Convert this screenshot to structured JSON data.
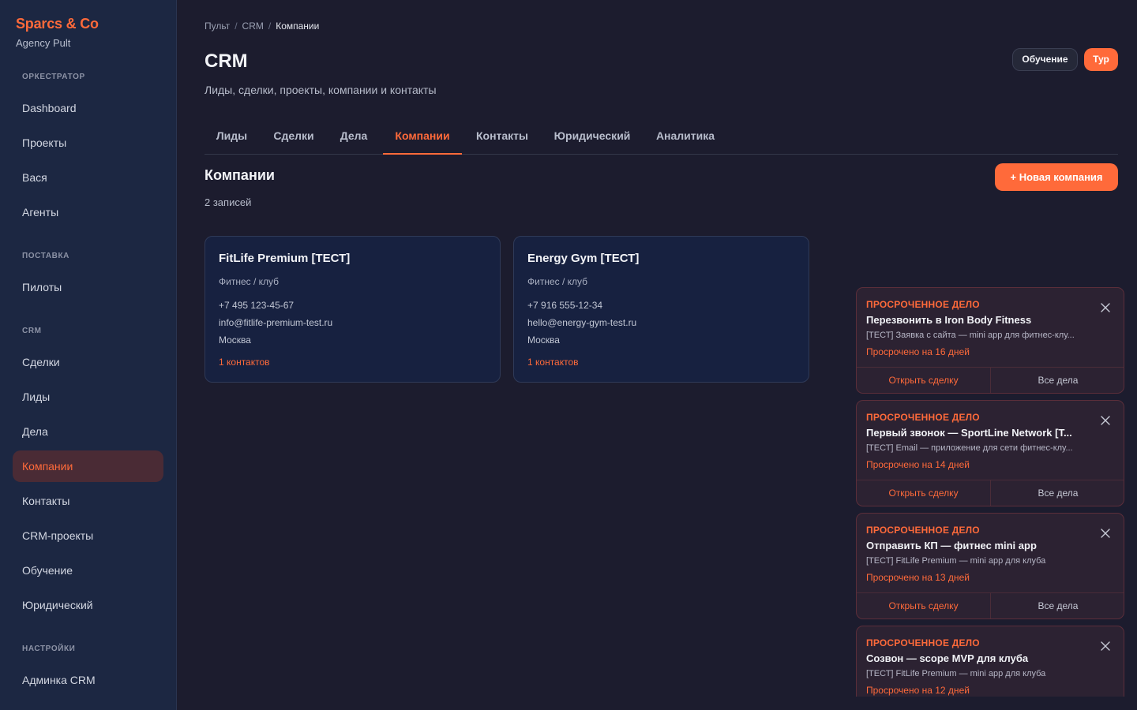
{
  "brand": {
    "name": "Sparcs & Co",
    "subtitle": "Agency Pult"
  },
  "sidebar": {
    "sections": [
      {
        "label": "ОРКЕСТРАТОР"
      },
      {
        "label": "ПОСТАВКА"
      },
      {
        "label": "CRM"
      },
      {
        "label": "НАСТРОЙКИ"
      }
    ],
    "items": [
      {
        "label": "Dashboard"
      },
      {
        "label": "Проекты"
      },
      {
        "label": "Вася"
      },
      {
        "label": "Агенты"
      },
      {
        "label": "Пилоты"
      },
      {
        "label": "Сделки"
      },
      {
        "label": "Лиды"
      },
      {
        "label": "Дела"
      },
      {
        "label": "Компании",
        "active": true
      },
      {
        "label": "Контакты"
      },
      {
        "label": "CRM-проекты"
      },
      {
        "label": "Обучение"
      },
      {
        "label": "Юридический"
      },
      {
        "label": "Админка CRM"
      }
    ]
  },
  "breadcrumb": {
    "items": [
      "Пульт",
      "CRM",
      "Компании"
    ],
    "sep": "/"
  },
  "header": {
    "title": "CRM",
    "subtitle": "Лиды, сделки, проекты, компании и контакты",
    "learn_label": "Обучение",
    "tour_label": "Тур"
  },
  "tabs": [
    {
      "label": "Лиды"
    },
    {
      "label": "Сделки"
    },
    {
      "label": "Дела"
    },
    {
      "label": "Компании",
      "active": true
    },
    {
      "label": "Контакты"
    },
    {
      "label": "Юридический"
    },
    {
      "label": "Аналитика"
    }
  ],
  "companies_section": {
    "title": "Компании",
    "count": "2 записей",
    "new_button": "+ Новая компания"
  },
  "companies": [
    {
      "name": "FitLife Premium [ТЕСТ]",
      "type": "Фитнес / клуб",
      "phone": "+7 495 123-45-67",
      "email": "info@fitlife-premium-test.ru",
      "city": "Москва",
      "contacts": "1 контактов"
    },
    {
      "name": "Energy Gym [ТЕСТ]",
      "type": "Фитнес / клуб",
      "phone": "+7 916 555-12-34",
      "email": "hello@energy-gym-test.ru",
      "city": "Москва",
      "contacts": "1 контактов"
    }
  ],
  "notifications": [
    {
      "label": "ПРОСРОЧЕННОЕ ДЕЛО",
      "title": "Перезвонить в Iron Body Fitness",
      "desc": "[ТЕСТ] Заявка с сайта — mini app для фитнес-клу...",
      "overdue": "Просрочено на 16 дней",
      "open_label": "Открыть сделку",
      "all_label": "Все дела"
    },
    {
      "label": "ПРОСРОЧЕННОЕ ДЕЛО",
      "title": "Первый звонок — SportLine Network [Т...",
      "desc": "[ТЕСТ] Email — приложение для сети фитнес-клу...",
      "overdue": "Просрочено на 14 дней",
      "open_label": "Открыть сделку",
      "all_label": "Все дела"
    },
    {
      "label": "ПРОСРОЧЕННОЕ ДЕЛО",
      "title": "Отправить КП — фитнес mini app",
      "desc": "[ТЕСТ] FitLife Premium — mini app для клуба",
      "overdue": "Просрочено на 13 дней",
      "open_label": "Открыть сделку",
      "all_label": "Все дела"
    },
    {
      "label": "ПРОСРОЧЕННОЕ ДЕЛО",
      "title": "Созвон — scope MVP для клуба",
      "desc": "[ТЕСТ] FitLife Premium — mini app для клуба",
      "overdue": "Просрочено на 12 дней"
    }
  ],
  "colors": {
    "accent": "#ff6a3a",
    "background": "#1c1c2e",
    "sidebar": "#1c2742",
    "card": "#172140",
    "toast": "#2c2232"
  }
}
